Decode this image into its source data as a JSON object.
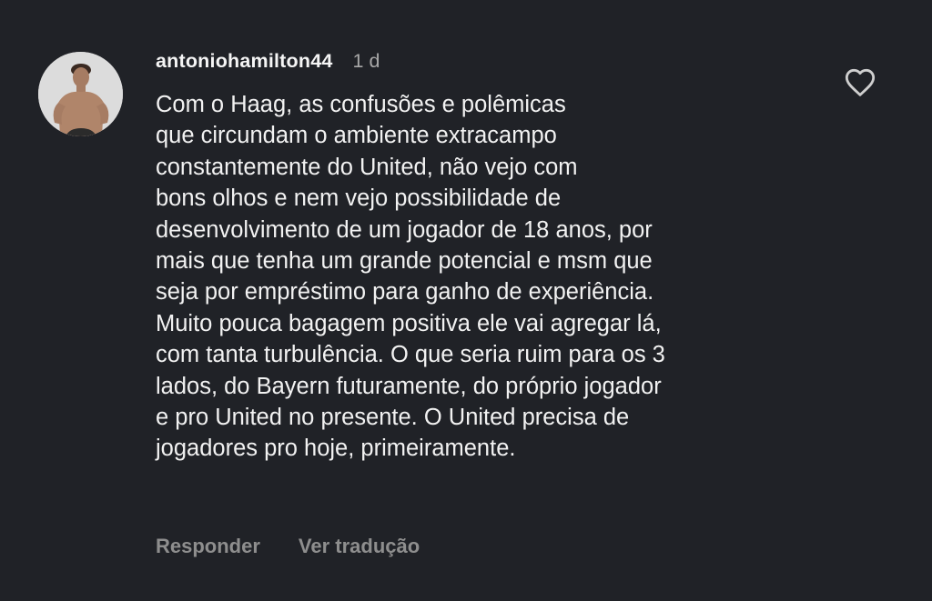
{
  "comment": {
    "avatar_icon": "user-avatar",
    "username": "antoniohamilton44",
    "timestamp": "1 d",
    "body_lines": [
      "Com o Haag, as confusões e polêmicas",
      "que circundam o ambiente extracampo",
      "constantemente do United, não vejo com",
      "bons olhos e nem vejo possibilidade de",
      "desenvolvimento de um jogador de 18 anos, por",
      "mais que tenha um grande potencial e msm que",
      "seja por empréstimo para ganho de experiência.",
      "Muito pouca bagagem positiva ele vai agregar lá,",
      "com tanta turbulência. O que seria ruim para os 3",
      "lados, do Bayern futuramente, do próprio jogador",
      "e pro United no presente. O United precisa de",
      "jogadores pro hoje, primeiramente."
    ],
    "actions": {
      "reply_label": "Responder",
      "translate_label": "Ver tradução"
    },
    "like_icon": "heart-outline-icon"
  },
  "colors": {
    "background": "#202227",
    "text": "#f2f2f2",
    "muted": "#a8a8a8",
    "action": "#8e8e8e"
  }
}
